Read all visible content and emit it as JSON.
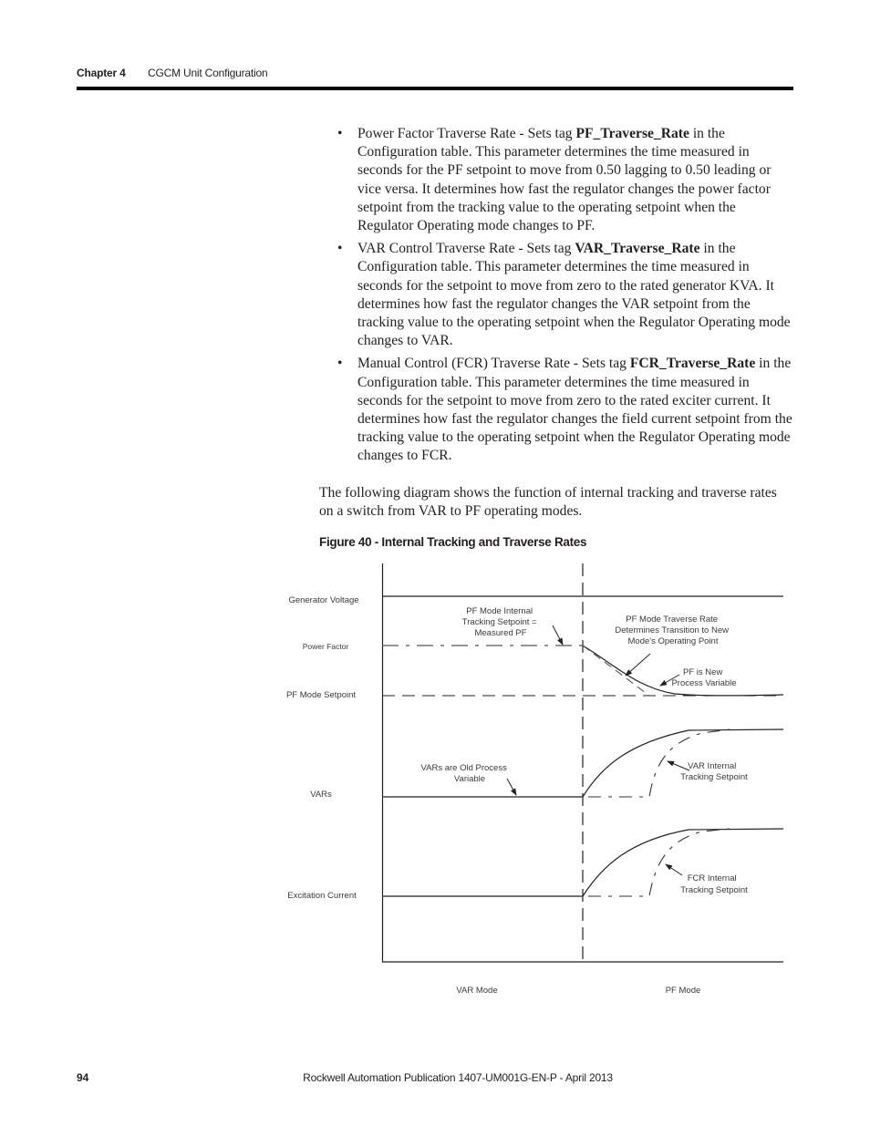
{
  "header": {
    "chapter": "Chapter 4",
    "title": "CGCM Unit Configuration"
  },
  "bullets": [
    {
      "pre": "Power Factor Traverse Rate - Sets tag ",
      "tag": "PF_Traverse_Rate",
      "post": " in the Configuration table. This parameter determines the time measured in seconds for the PF setpoint to move from 0.50 lagging to 0.50 leading or vice versa. It determines how fast the regulator changes the power factor setpoint from the tracking value to the operating setpoint when the Regulator Operating mode changes to PF."
    },
    {
      "pre": "VAR Control Traverse Rate - Sets tag ",
      "tag": "VAR_Traverse_Rate",
      "post": " in the Configuration table. This parameter determines the time measured in seconds for the setpoint to move from zero to the rated generator KVA. It determines how fast the regulator changes the VAR setpoint from the tracking value to the operating setpoint when the Regulator Operating mode changes to VAR."
    },
    {
      "pre": "Manual Control (FCR) Traverse Rate - Sets tag ",
      "tag": "FCR_Traverse_Rate",
      "post": " in the Configuration table. This parameter determines the time measured in seconds for the setpoint to move from zero to the rated exciter current. It determines how fast the regulator changes the field current setpoint from the tracking value to the operating setpoint when the Regulator Operating mode changes to FCR."
    }
  ],
  "bullet_glyph": "•",
  "paragraph": "The following diagram shows the function of internal tracking and traverse rates on a switch from VAR to PF operating modes.",
  "figure": {
    "caption": "Figure 40 - Internal Tracking and Traverse Rates",
    "row_labels": {
      "generator_voltage": "Generator Voltage",
      "power_factor": "Power Factor",
      "pf_mode_setpoint": "PF Mode Setpoint",
      "vars": "VARs",
      "excitation_current": "Excitation Current"
    },
    "annotations": {
      "pf_tracking": [
        "PF Mode Internal",
        "Tracking Setpoint =",
        "Measured PF"
      ],
      "pf_traverse": [
        "PF Mode Traverse Rate",
        "Determines Transition to New",
        "Mode's Operating Point"
      ],
      "pf_new_pv": [
        "PF is New",
        "Process Variable"
      ],
      "vars_old_pv": [
        "VARs are Old Process",
        "Variable"
      ],
      "var_tracking": [
        "VAR Internal",
        "Tracking Setpoint"
      ],
      "fcr_tracking": [
        "FCR  Internal",
        "Tracking Setpoint"
      ]
    },
    "mode_labels": {
      "left": "VAR Mode",
      "right": "PF Mode"
    }
  },
  "footer": {
    "page_number": "94",
    "publication": "Rockwell Automation Publication 1407-UM001G-EN-P - April 2013"
  }
}
